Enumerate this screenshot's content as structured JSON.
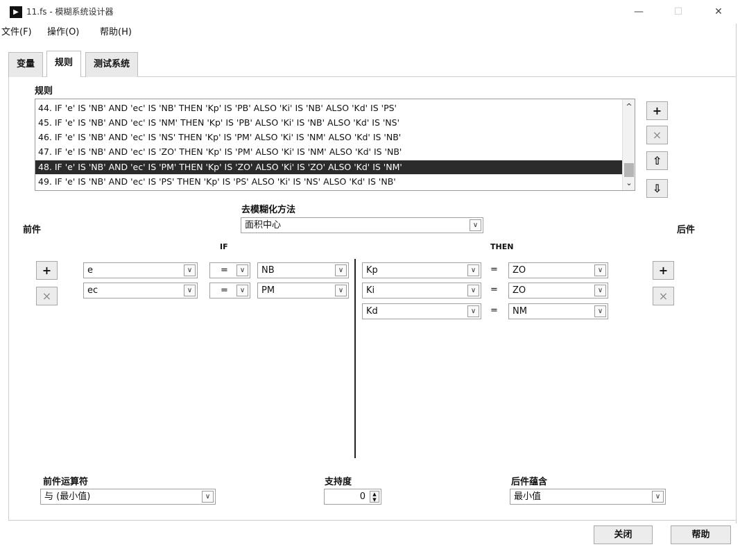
{
  "window": {
    "title": "11.fs - 模糊系统设计器",
    "app_icon_glyph": "▶",
    "minimize_glyph": "—",
    "maximize_glyph": "☐",
    "close_glyph": "✕"
  },
  "menu": [
    "文件(F)",
    "操作(O)",
    "帮助(H)"
  ],
  "tabs": [
    "变量",
    "规则",
    "测试系统"
  ],
  "active_tab": "规则",
  "rules": {
    "label": "规则",
    "items": [
      "44. IF 'e' IS 'NB' AND 'ec' IS 'NB' THEN 'Kp' IS 'PB' ALSO 'Ki' IS 'NB' ALSO 'Kd' IS 'PS'",
      "45. IF 'e' IS 'NB' AND 'ec' IS 'NM' THEN 'Kp' IS 'PB' ALSO 'Ki' IS 'NB' ALSO 'Kd' IS 'NS'",
      "46. IF 'e' IS 'NB' AND 'ec' IS 'NS' THEN 'Kp' IS 'PM' ALSO 'Ki' IS 'NM' ALSO 'Kd' IS 'NB'",
      "47. IF 'e' IS 'NB' AND 'ec' IS 'ZO' THEN 'Kp' IS 'PM' ALSO 'Ki' IS 'NM' ALSO 'Kd' IS 'NB'",
      "48. IF 'e' IS 'NB' AND 'ec' IS 'PM' THEN 'Kp' IS 'ZO' ALSO 'Ki' IS 'ZO' ALSO 'Kd' IS 'NM'",
      "49. IF 'e' IS 'NB' AND 'ec' IS 'PS' THEN 'Kp' IS 'PS' ALSO 'Ki' IS 'NS' ALSO 'Kd' IS 'NB'"
    ],
    "selected_index": 4,
    "scroll_up_glyph": "^",
    "scroll_down_glyph": "⌄"
  },
  "rule_buttons": {
    "add": "+",
    "delete": "×",
    "move_up": "⇧",
    "move_down": "⇩"
  },
  "defuzz": {
    "label": "去模糊化方法",
    "value": "面积中心"
  },
  "antecedent": {
    "label": "前件",
    "header": "IF",
    "rows": [
      {
        "variable": "e",
        "operator": "=",
        "term": "NB"
      },
      {
        "variable": "ec",
        "operator": "=",
        "term": "PM"
      }
    ]
  },
  "consequent": {
    "label": "后件",
    "header": "THEN",
    "rows": [
      {
        "variable": "Kp",
        "operator": "=",
        "term": "ZO"
      },
      {
        "variable": "Ki",
        "operator": "=",
        "term": "ZO"
      },
      {
        "variable": "Kd",
        "operator": "=",
        "term": "NM"
      }
    ]
  },
  "side_buttons": {
    "add": "+",
    "delete": "×"
  },
  "combo_arrow": "∨",
  "antecedent_operator": {
    "label": "前件运算符",
    "value": "与 (最小值)"
  },
  "support": {
    "label": "支持度",
    "value": "0"
  },
  "consequent_implication": {
    "label": "后件蕴含",
    "value": "最小值"
  },
  "footer": {
    "close": "关闭",
    "help": "帮助"
  }
}
